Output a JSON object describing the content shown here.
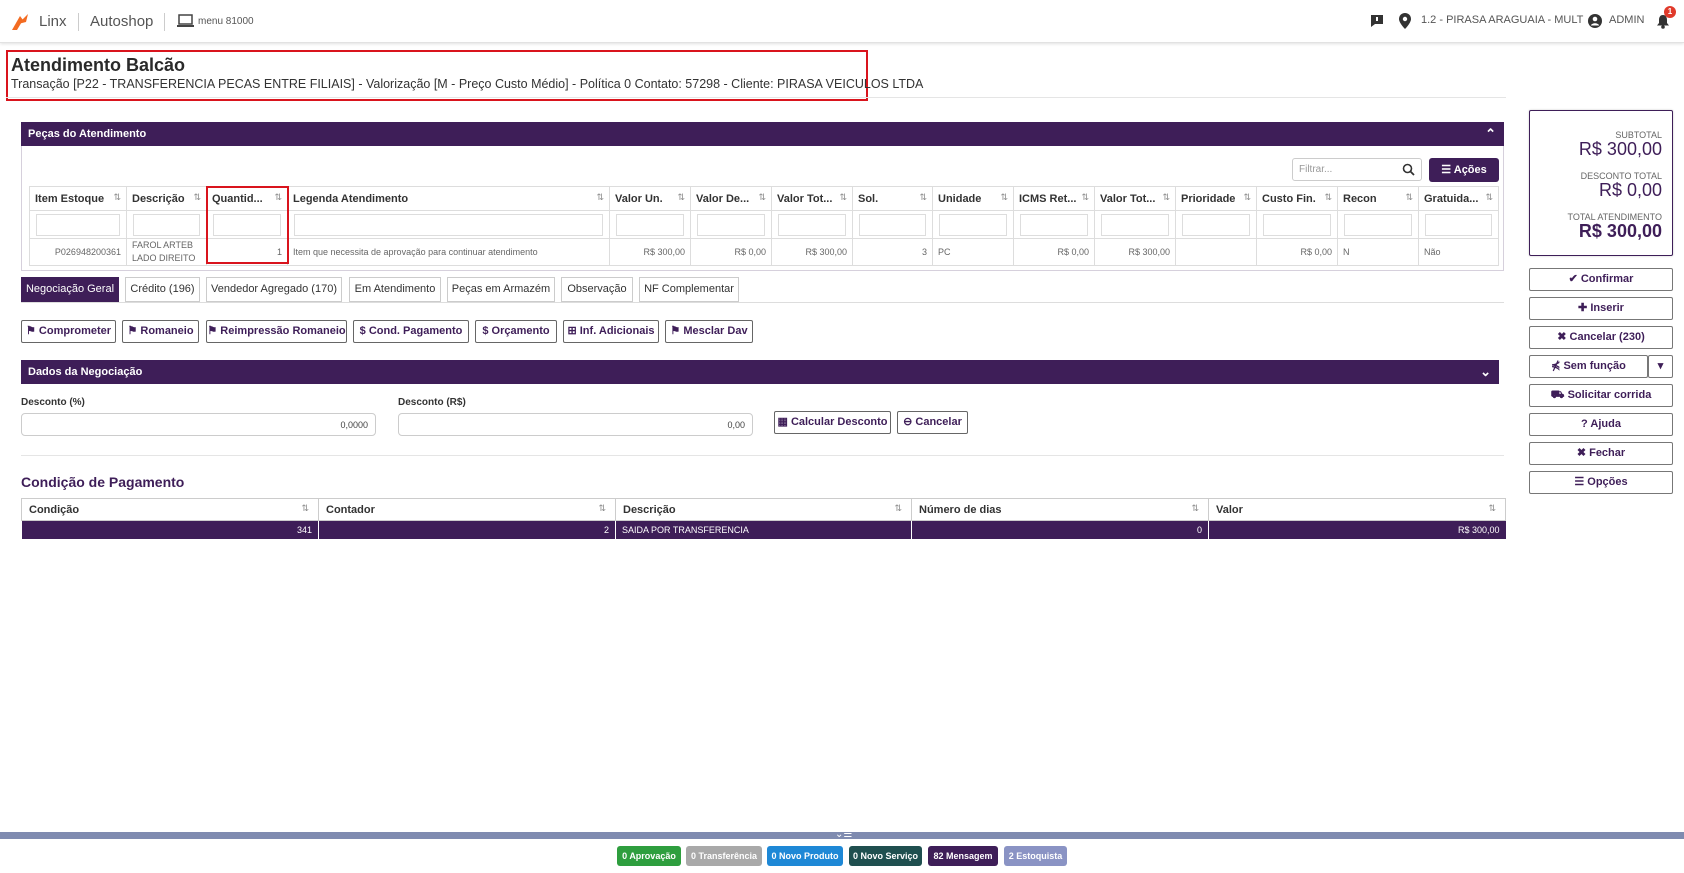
{
  "topbar": {
    "brand": "Linx",
    "app": "Autoshop",
    "menu_label": "menu 81000",
    "location": "1.2 - PIRASA ARAGUAIA - MULT",
    "user": "ADMIN",
    "notification_count": "1"
  },
  "header": {
    "title": "Atendimento Balcão",
    "subtitle": "Transação [P22 - TRANSFERENCIA PECAS ENTRE FILIAIS] - Valorização [M - Preço Custo Médio] - Política 0 Contato: 57298 - Cliente: PIRASA VEICULOS LTDA"
  },
  "pecas": {
    "title": "Peças do Atendimento",
    "filter_placeholder": "Filtrar...",
    "acoes_label": "Ações",
    "columns": [
      "Item Estoque",
      "Descrição",
      "Quantid...",
      "Legenda Atendimento",
      "Valor Un.",
      "Valor De...",
      "Valor Tot...",
      "Sol.",
      "Unidade",
      "ICMS Ret...",
      "Valor Tot...",
      "Prioridade",
      "Custo Fin.",
      "Recon",
      "Gratuida..."
    ],
    "row": {
      "item": "P026948200361",
      "descricao": "FAROL ARTEB LADO DIREITO",
      "quantidade": "1",
      "legenda": "Item que necessita de aprovação para continuar atendimento",
      "valor_un": "R$ 300,00",
      "valor_desc": "R$ 0,00",
      "valor_tot": "R$ 300,00",
      "sol": "3",
      "unidade": "PC",
      "icms_ret": "R$ 0,00",
      "valor_tot2": "R$ 300,00",
      "prioridade": "",
      "custo_fin": "R$ 0,00",
      "recon": "N",
      "gratuidade": "Não"
    }
  },
  "tabs": [
    "Negociação Geral",
    "Crédito (196)",
    "Vendedor Agregado (170)",
    "Em Atendimento",
    "Peças em Armazém",
    "Observação",
    "NF Complementar"
  ],
  "actions": [
    "Comprometer",
    "Romaneio",
    "Reimpressão Romaneio",
    "Cond. Pagamento",
    "Orçamento",
    "Inf. Adicionais",
    "Mesclar Dav"
  ],
  "negociacao": {
    "title": "Dados da Negociação",
    "desconto_pct_label": "Desconto (%)",
    "desconto_pct_value": "0,0000",
    "desconto_rs_label": "Desconto (R$)",
    "desconto_rs_value": "0,00",
    "calcular_label": "Calcular Desconto",
    "cancelar_label": "Cancelar"
  },
  "condicao": {
    "title": "Condição de Pagamento",
    "columns": [
      "Condição",
      "Contador",
      "Descrição",
      "Número de dias",
      "Valor"
    ],
    "row": [
      "341",
      "2",
      "SAIDA POR TRANSFERENCIA",
      "0",
      "R$ 300,00"
    ]
  },
  "summary": {
    "subtotal_label": "SUBTOTAL",
    "subtotal": "R$ 300,00",
    "desconto_label": "DESCONTO TOTAL",
    "desconto": "R$ 0,00",
    "total_label": "TOTAL ATENDIMENTO",
    "total": "R$ 300,00"
  },
  "side_buttons": [
    "Confirmar",
    "Inserir",
    "Cancelar (230)",
    "Sem função",
    "Solicitar corrida",
    "Ajuda",
    "Fechar",
    "Opções"
  ],
  "badges": [
    {
      "label": "0 Aprovação",
      "color": "#2e9e3e"
    },
    {
      "label": "0 Transferência",
      "color": "#a9a9a9"
    },
    {
      "label": "0 Novo Produto",
      "color": "#1e88d6"
    },
    {
      "label": "0 Novo Serviço",
      "color": "#1f4f4f"
    },
    {
      "label": "82 Mensagem",
      "color": "#3e1e58"
    },
    {
      "label": "2 Estoquista",
      "color": "#8a93c4"
    }
  ]
}
